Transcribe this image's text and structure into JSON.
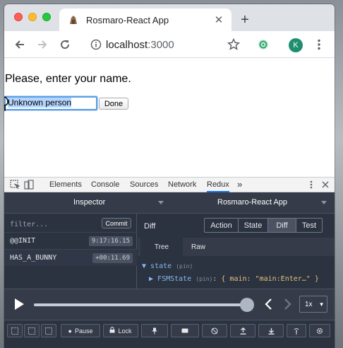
{
  "browser": {
    "tab_title": "Rosmaro-React App",
    "tab_close": "✕",
    "new_tab": "+",
    "url_host": "localhost",
    "url_port": ":3000",
    "avatar_letter": "K"
  },
  "page": {
    "heading": "Please, enter your name.",
    "name_value": "Unknown person",
    "done_label": "Done"
  },
  "devtools": {
    "tabs": [
      "Elements",
      "Console",
      "Sources",
      "Network",
      "Redux"
    ],
    "active_tab": "Redux",
    "more": "»"
  },
  "redux": {
    "inspector_label": "Inspector",
    "instance_label": "Rosmaro-React App",
    "filter_placeholder": "filter...",
    "commit_label": "Commit",
    "actions": [
      {
        "name": "@@INIT",
        "time": "9:17:16.15"
      },
      {
        "name": "HAS_A_BUNNY",
        "time": "+00:11.69"
      }
    ],
    "panel_label": "Diff",
    "segments": [
      "Action",
      "State",
      "Diff",
      "Test"
    ],
    "active_segment": "Diff",
    "subtabs": [
      "Tree",
      "Raw"
    ],
    "active_subtab": "Tree",
    "tree": {
      "root_key": "state",
      "root_meta": "(pin)",
      "child_key": "FSMState",
      "child_meta": "(pin)",
      "child_value": ": { main: \"main:Enter…\" }"
    },
    "slider_progress": 1.0,
    "speed": "1x",
    "buttons": {
      "pause": "Pause",
      "lock": "Lock"
    }
  }
}
